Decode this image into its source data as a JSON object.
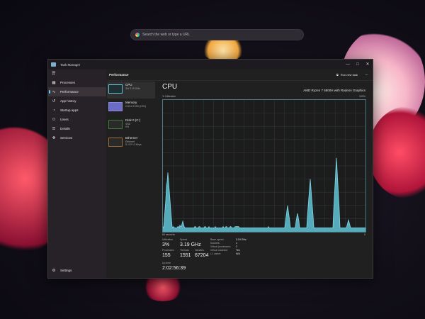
{
  "desktop": {
    "search_placeholder": "Search the web or type a URL"
  },
  "window": {
    "title": "Task Manager",
    "controls": [
      "—",
      "□",
      "✕"
    ]
  },
  "sidebar": {
    "items": [
      {
        "label": "Processes",
        "icon": "grid-icon",
        "glyph": "▦"
      },
      {
        "label": "Performance",
        "icon": "pulse-icon",
        "glyph": "∿"
      },
      {
        "label": "App history",
        "icon": "history-icon",
        "glyph": "↺"
      },
      {
        "label": "Startup apps",
        "icon": "speedometer-icon",
        "glyph": "◔"
      },
      {
        "label": "Users",
        "icon": "users-icon",
        "glyph": "⚇"
      },
      {
        "label": "Details",
        "icon": "list-icon",
        "glyph": "☰"
      },
      {
        "label": "Services",
        "icon": "puzzle-icon",
        "glyph": "✥"
      }
    ],
    "settings_label": "Settings",
    "settings_glyph": "⚙"
  },
  "header": {
    "title": "Performance",
    "run_new_task": "Run new task",
    "more": "⋯"
  },
  "devices": [
    {
      "name": "CPU",
      "sub": "3%  3.19 GHz",
      "kind": "cpu"
    },
    {
      "name": "Memory",
      "sub": "2.8/14.9 GB (19%)",
      "kind": "mem"
    },
    {
      "name": "Disk 0 (C:)",
      "sub": "SSD",
      "sub2": "0%",
      "kind": "disk"
    },
    {
      "name": "Ethernet",
      "sub": "Ethernet",
      "sub2": "S: 0  R: 0 Kbps",
      "kind": "eth"
    }
  ],
  "cpu": {
    "title": "CPU",
    "model": "AMD Ryzen 7 5800H with Radeon Graphics",
    "util_label": "% Utilization",
    "util_max": "100%",
    "footer_left": "60 seconds",
    "footer_right": "0",
    "utilization_samples": [
      4,
      3,
      3,
      2,
      2,
      35,
      10,
      6,
      6,
      5,
      4,
      4,
      4,
      4,
      3,
      4,
      3,
      3,
      3,
      3,
      3,
      4,
      4,
      3,
      5,
      4,
      4,
      3,
      3,
      4,
      3,
      3,
      3,
      3,
      3,
      3,
      3,
      3,
      3,
      3,
      3,
      3,
      3,
      3,
      3,
      4,
      4,
      3,
      3,
      3,
      3,
      4,
      4,
      3,
      3,
      3,
      3,
      3,
      3,
      4,
      4,
      3,
      3,
      3,
      3,
      4,
      3,
      3,
      3,
      3,
      3,
      3,
      3,
      3,
      4,
      3,
      3,
      3,
      3,
      3,
      3,
      3,
      3,
      3,
      3,
      4,
      3,
      3,
      3,
      4,
      4,
      3,
      3,
      3,
      3,
      4,
      4,
      3,
      3,
      3,
      3,
      3,
      4,
      4,
      4,
      4,
      4,
      4,
      3,
      3,
      3,
      3,
      3,
      3,
      3,
      3,
      3,
      3,
      3,
      3,
      3,
      3,
      3,
      3,
      3,
      3,
      3,
      3,
      3,
      3,
      3,
      3,
      3,
      3,
      3,
      3,
      3,
      3,
      3,
      3,
      3,
      3,
      3,
      3,
      3,
      3,
      3,
      3,
      3,
      4,
      3,
      3,
      3,
      3,
      3,
      3,
      3,
      3,
      3,
      3,
      3,
      3,
      3,
      3,
      3,
      3,
      3,
      3,
      3,
      3,
      3,
      3,
      3,
      3,
      3,
      3,
      3,
      3,
      3,
      3,
      3,
      3,
      3,
      3,
      3,
      3,
      3,
      3,
      3,
      3,
      3,
      3,
      3,
      3,
      3,
      3,
      3,
      3,
      3,
      3,
      3,
      3,
      3,
      3,
      3,
      3,
      3,
      3,
      3,
      3,
      3,
      3,
      3,
      3,
      3,
      3,
      3,
      3,
      3,
      3,
      3,
      3,
      3,
      3,
      3,
      3,
      3,
      3,
      3,
      3,
      3,
      3,
      3,
      3,
      3,
      3,
      3,
      3,
      3,
      3,
      3,
      3,
      3,
      3,
      3,
      3,
      3,
      3,
      3,
      3,
      3,
      3,
      3,
      3,
      3,
      3,
      3,
      3,
      3,
      3,
      3,
      3,
      3,
      3,
      3,
      3,
      3,
      3,
      3,
      3,
      3,
      3,
      3,
      3,
      3,
      3,
      3,
      3,
      3,
      3,
      3,
      3,
      3,
      3,
      3,
      3,
      3,
      3,
      3,
      3,
      3,
      3,
      3,
      3,
      3,
      3,
      3,
      3,
      3,
      3,
      3,
      3,
      3
    ],
    "stats": {
      "utilization_label": "Utilization",
      "utilization": "3%",
      "speed_label": "Speed",
      "speed": "3.19 GHz",
      "processes_label": "Processes",
      "processes": "155",
      "threads_label": "Threads",
      "threads": "1551",
      "handles_label": "Handles",
      "handles": "67204",
      "uptime_label": "Up time",
      "uptime": "2:02:56:39"
    },
    "details": [
      {
        "k": "Base speed:",
        "v": "3.19 GHz"
      },
      {
        "k": "Sockets:",
        "v": "1"
      },
      {
        "k": "Virtual processors:",
        "v": "2"
      },
      {
        "k": "Virtual machine:",
        "v": "Yes"
      },
      {
        "k": "L1 cache:",
        "v": "N/A"
      }
    ]
  },
  "colors": {
    "graph_fill": "#5fc4d6",
    "graph_line": "#7fd6e6",
    "grid": "#2f3a3c",
    "accent": "#60cdff"
  }
}
